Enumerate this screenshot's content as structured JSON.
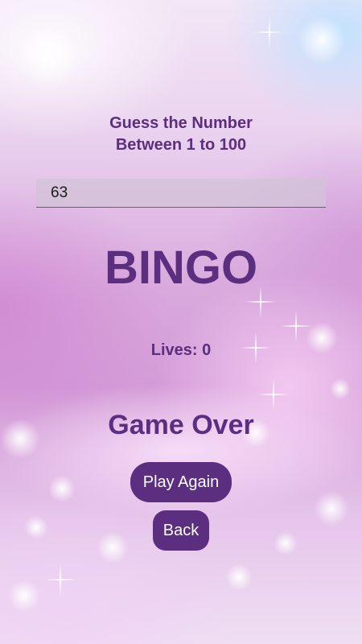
{
  "prompt": {
    "line1": "Guess the Number",
    "line2": "Between 1 to 100"
  },
  "guess_input": {
    "value": "63"
  },
  "result_text": "BINGO",
  "lives": {
    "text": "Lives: 0"
  },
  "status_text": "Game Over",
  "buttons": {
    "play_again": "Play Again",
    "back": "Back"
  },
  "colors": {
    "accent": "#5b2e7f",
    "button_text": "#ffffff"
  }
}
